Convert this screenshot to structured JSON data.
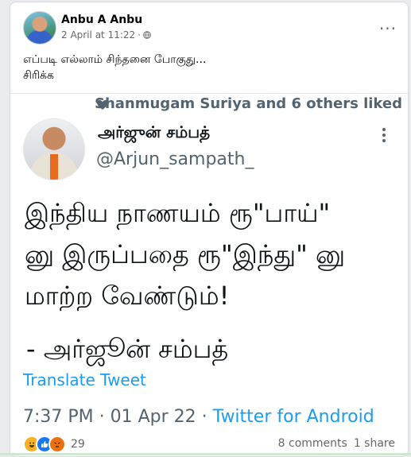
{
  "post": {
    "author": "Anbu A Anbu",
    "timestamp": "2 April at 11:22",
    "separator": "·",
    "more_label": "···",
    "caption_lines": [
      "எப்படி எல்லாம் சிந்தனை போகுது...",
      "சிரிக்க"
    ]
  },
  "tweet": {
    "liked_by": "Shanmugam Suriya and 6 others liked",
    "name": "அர்ஜுன் சம்பத்",
    "handle": "@Arjun_sampath_",
    "body_lines": [
      "இந்திய நாணயம்  ரூ\"பாய்\"",
      "னு  இருப்பதை ரூ\"இந்து\" னு",
      "மாற்ற வேண்டும்!"
    ],
    "signature": "- அர்ஜூன் சம்பத்",
    "translate_label": "Translate Tweet",
    "time": "7:37 PM · 01 Apr 22 · ",
    "source": "Twitter for Android"
  },
  "footer": {
    "reaction_count": "29",
    "comments": "8 comments",
    "shares": "1 share"
  },
  "icons": [
    "globe-icon",
    "heart-icon",
    "more-vertical-icon",
    "haha-reaction-icon",
    "like-reaction-icon",
    "angry-reaction-icon"
  ],
  "colors": {
    "link": "#1d9bf0",
    "twitter_grey": "#536471",
    "fb_grey": "#65676b"
  }
}
